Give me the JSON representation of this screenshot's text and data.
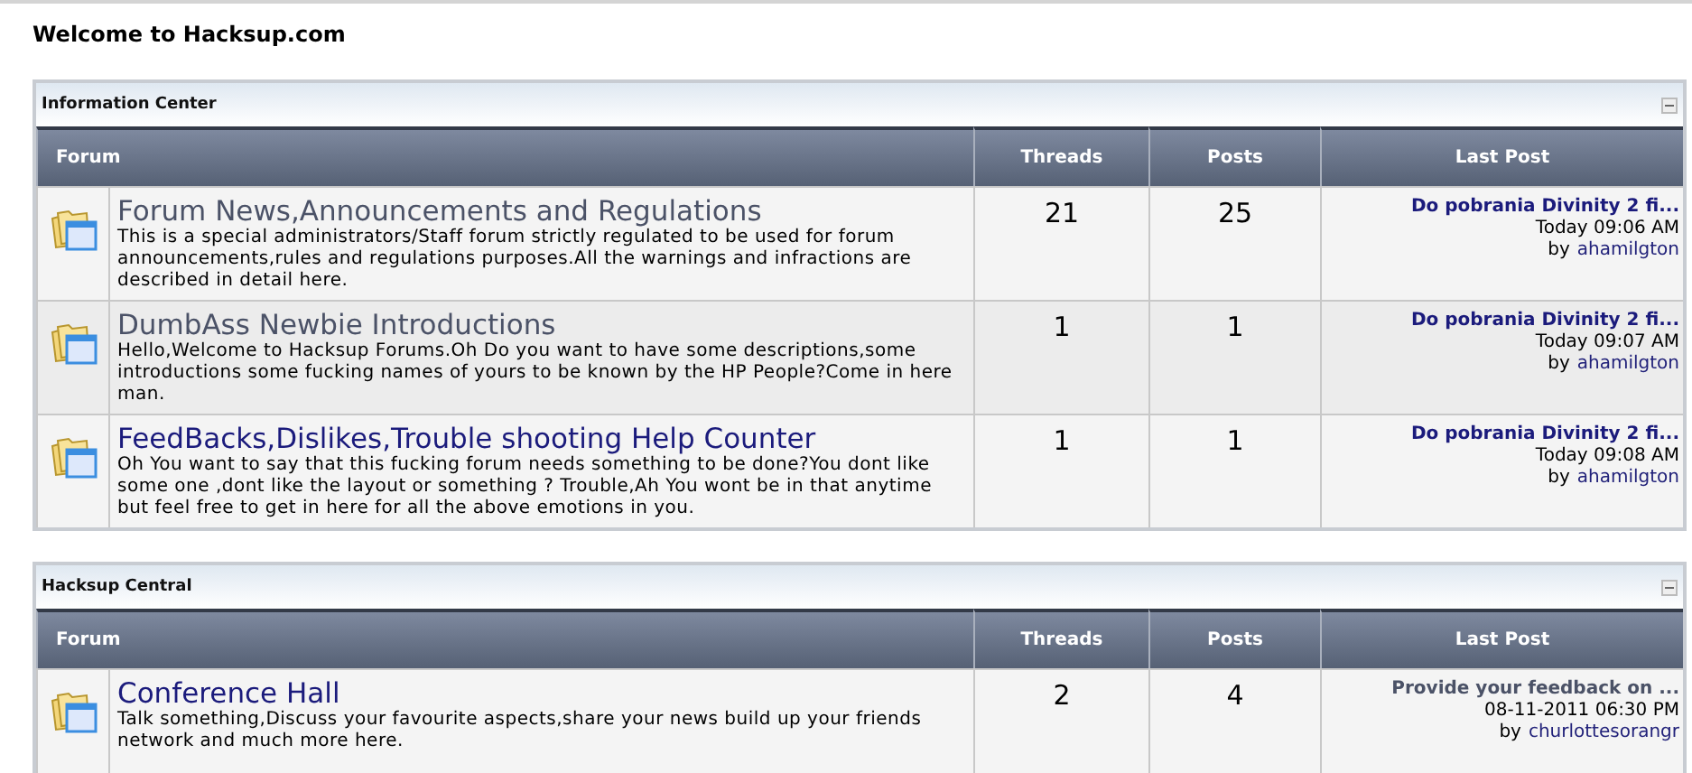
{
  "page_title": "Welcome to Hacksup.com",
  "sections": [
    {
      "title": "Information Center",
      "columns": [
        "Forum",
        "Threads",
        "Posts",
        "Last Post"
      ],
      "forums": [
        {
          "title": "Forum News,Announcements and Regulations",
          "visited": true,
          "description": "This is a special administrators/Staff forum strictly regulated to be used for forum announcements,rules and regulations purposes.All the warnings and infractions are described in detail here.",
          "threads": "21",
          "posts": "25",
          "last_post": {
            "title": "Do pobrania Divinity 2 fi...",
            "visited": false,
            "time": "Today 09:06 AM",
            "by": "by",
            "user": "ahamilgton"
          }
        },
        {
          "title": "DumbAss Newbie Introductions",
          "visited": true,
          "description": "Hello,Welcome to Hacksup Forums.Oh Do you want to have some descriptions,some introductions some fucking names of yours to be known by the HP People?Come in here man.",
          "threads": "1",
          "posts": "1",
          "last_post": {
            "title": "Do pobrania Divinity 2 fi...",
            "visited": false,
            "time": "Today 09:07 AM",
            "by": "by",
            "user": "ahamilgton"
          }
        },
        {
          "title": "FeedBacks,Dislikes,Trouble shooting Help Counter",
          "visited": false,
          "description": "Oh You want to say that this fucking forum needs something to be done?You dont like some one ,dont like the layout or something ? Trouble,Ah You wont be in that anytime but feel free to get in here for all the above emotions in you.",
          "threads": "1",
          "posts": "1",
          "last_post": {
            "title": "Do pobrania Divinity 2 fi...",
            "visited": false,
            "time": "Today 09:08 AM",
            "by": "by",
            "user": "ahamilgton"
          }
        }
      ]
    },
    {
      "title": "Hacksup Central",
      "columns": [
        "Forum",
        "Threads",
        "Posts",
        "Last Post"
      ],
      "forums": [
        {
          "title": "Conference Hall",
          "visited": false,
          "description": "Talk something,Discuss your favourite aspects,share your news build up your friends network and much more here.",
          "threads": "2",
          "posts": "4",
          "last_post": {
            "title": "Provide your feedback on ...",
            "visited": true,
            "time": "08-11-2011 06:30 PM",
            "by": "by",
            "user": "churlottesorangr"
          }
        }
      ]
    }
  ]
}
